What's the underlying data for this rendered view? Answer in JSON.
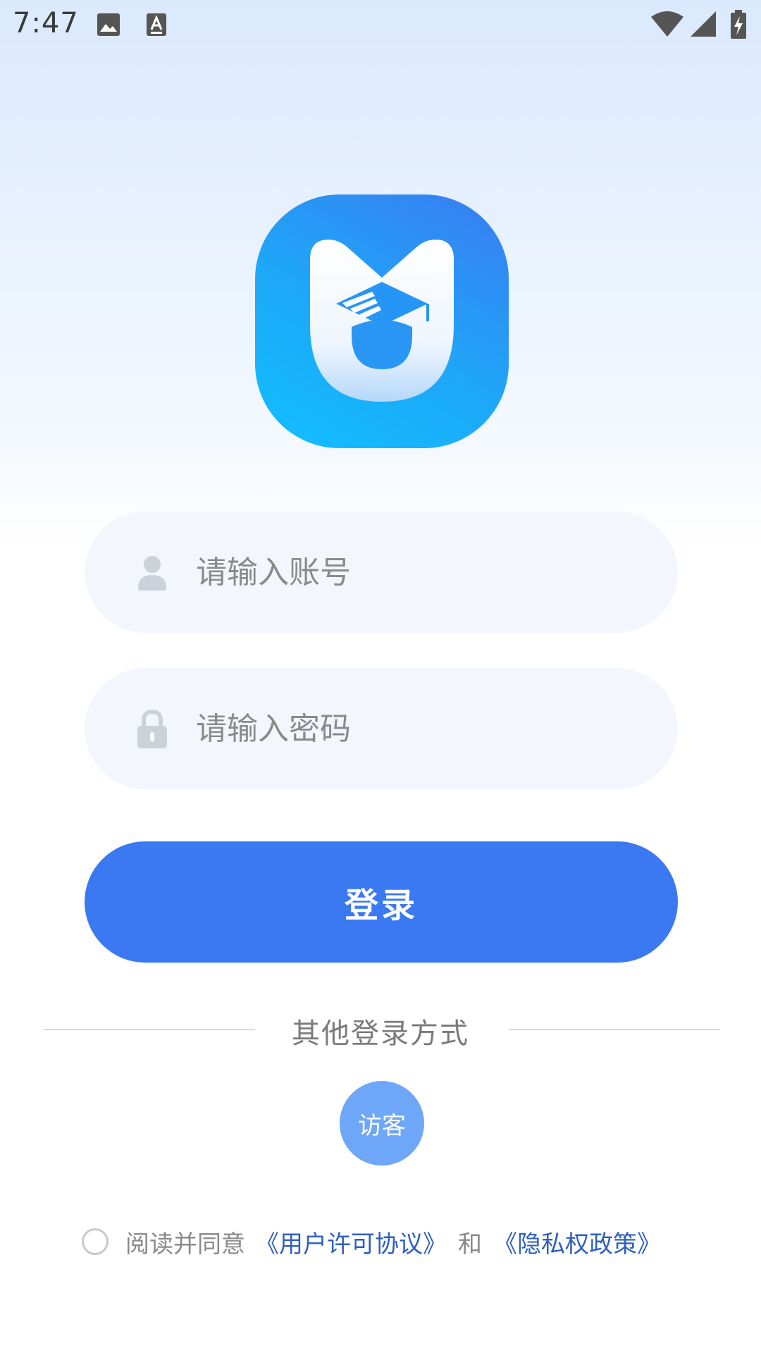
{
  "status_bar": {
    "time": "7:47",
    "left_icons": [
      "image-icon",
      "keyboard-a-icon"
    ],
    "right_icons": [
      "wifi-icon",
      "signal-icon",
      "battery-charging-icon"
    ]
  },
  "logo": {
    "icon": "graduation-cap-shield-logo",
    "colors": {
      "gradient_start": "#11c0ff",
      "gradient_end": "#3a7cf2"
    }
  },
  "account_field": {
    "icon": "user-icon",
    "placeholder": "请输入账号",
    "value": ""
  },
  "password_field": {
    "icon": "lock-icon",
    "placeholder": "请输入密码",
    "value": ""
  },
  "login_button": {
    "label": "登录",
    "color": "#3b79f2"
  },
  "other_login": {
    "label": "其他登录方式",
    "guest_label": "访客",
    "guest_color": "#6ea7f7"
  },
  "agreement": {
    "checked": false,
    "prefix": "阅读并同意",
    "user_license_link": "《用户许可协议》",
    "and": "和",
    "privacy_link": "《隐私权政策》"
  }
}
